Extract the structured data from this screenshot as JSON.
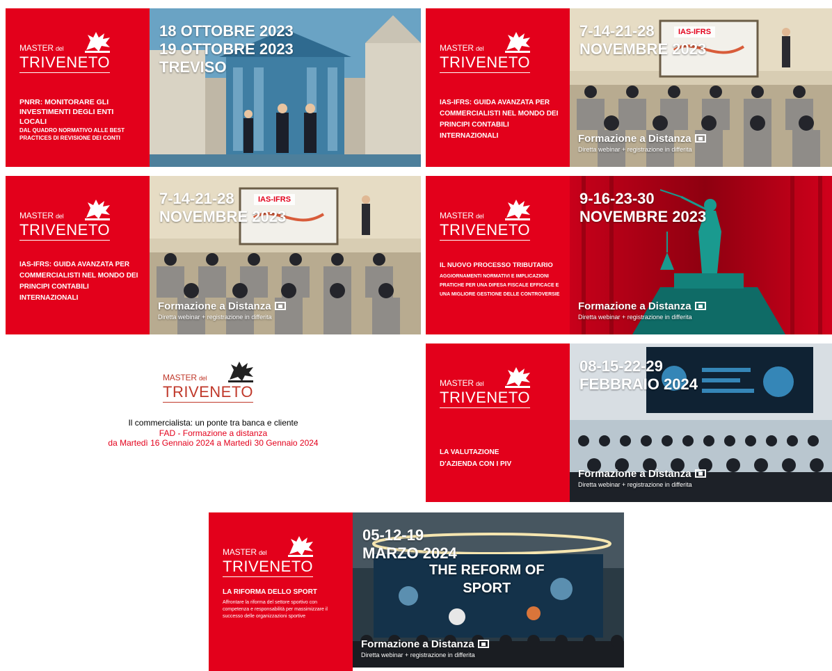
{
  "brand": {
    "master": "MASTER",
    "del": "del",
    "triveneto": "TRIVENETO"
  },
  "banners": [
    {
      "date": "18 OTTOBRE 2023\n19 OTTOBRE 2023\nTREVISO",
      "title": "PNRR: MONITORARE GLI INVESTIMENTI DEGLI ENTI LOCALI",
      "subtitle": "DAL QUADRO NORMATIVO ALLE BEST PRACTICES DI REVISIONE DEI CONTI"
    },
    {
      "date": "7-14-21-28\nNOVEMBRE 2023",
      "tag": "IAS-IFRS",
      "title": "IAS-IFRS: GUIDA AVANZATA PER COMMERCIALISTI NEL MONDO DEI PRINCIPI CONTABILI INTERNAZIONALI",
      "fad_title": "Formazione a Distanza",
      "fad_sub": "Diretta webinar + registrazione in differita"
    },
    {
      "date": "7-14-21-28\nNOVEMBRE 2023",
      "tag": "IAS-IFRS",
      "title": "IAS-IFRS: GUIDA AVANZATA PER COMMERCIALISTI NEL MONDO DEI PRINCIPI CONTABILI INTERNAZIONALI",
      "fad_title": "Formazione a Distanza",
      "fad_sub": "Diretta webinar + registrazione in differita"
    },
    {
      "date": "9-16-23-30\nNOVEMBRE 2023",
      "title": "IL NUOVO PROCESSO TRIBUTARIO",
      "subtitle": "AGGIORNAMENTI NORMATIVI E IMPLICAZIONI PRATICHE PER UNA DIFESA FISCALE EFFICACE E UNA MIGLIORE GESTIONE DELLE CONTROVERSIE",
      "fad_title": "Formazione a Distanza",
      "fad_sub": "Diretta webinar + registrazione in differita"
    },
    {
      "date": "08-15-22-29\nFEBBRAIO 2024",
      "title": "LA VALUTAZIONE D'AZIENDA CON I PIV",
      "fad_title": "Formazione a Distanza",
      "fad_sub": "Diretta webinar + registrazione in differita"
    },
    {
      "date": "05-12-19\nMARZO 2024",
      "title": "LA RIFORMA DELLO SPORT",
      "subtitle": "Affrontare la riforma del settore sportivo con competenza e responsabilità per massimizzare il successo delle organizzazioni sportive",
      "headline": "THE REFORM OF\nSPORT",
      "fad_title": "Formazione a Distanza",
      "fad_sub": "Diretta webinar + registrazione in differita"
    }
  ],
  "placeholder": {
    "course": "Il commercialista: un ponte tra banca e cliente",
    "mode": "FAD - Formazione a distanza",
    "dates": "da Martedì 16 Gennaio 2024 a Martedì 30 Gennaio 2024"
  },
  "colors": {
    "brand_red": "#e3001b"
  }
}
